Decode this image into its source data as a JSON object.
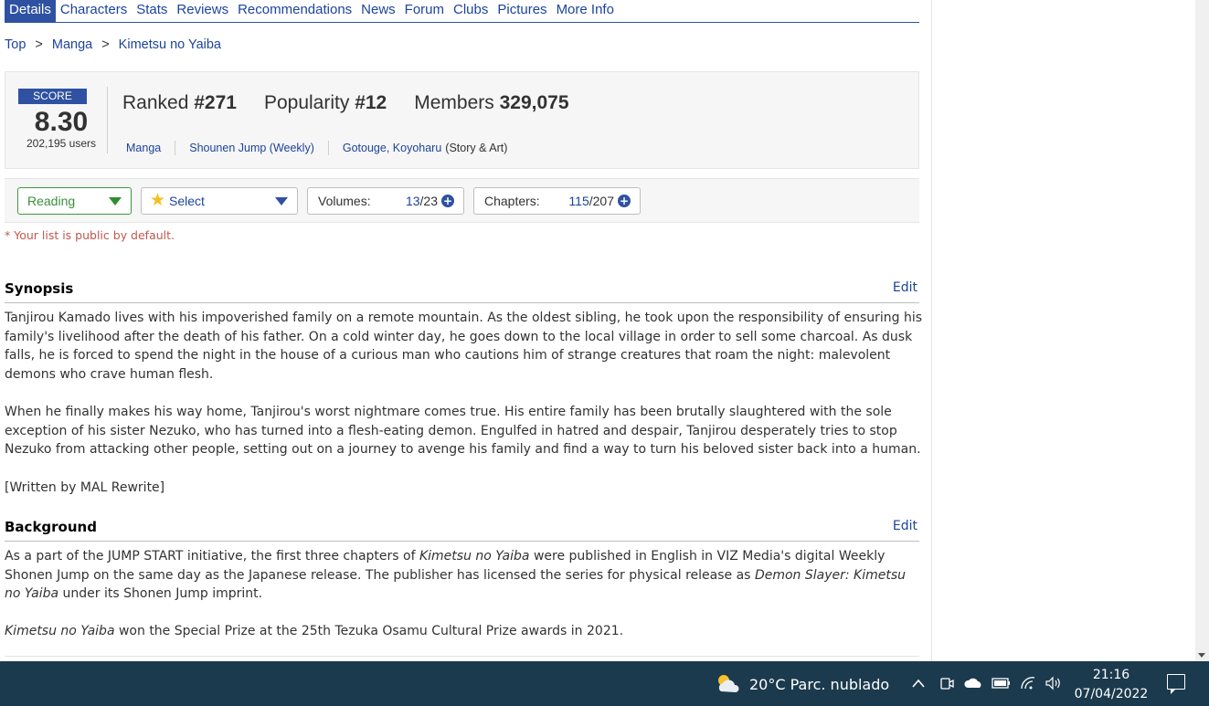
{
  "tabs": [
    "Details",
    "Characters",
    "Stats",
    "Reviews",
    "Recommendations",
    "News",
    "Forum",
    "Clubs",
    "Pictures",
    "More Info"
  ],
  "breadcrumb": {
    "top": "Top",
    "sep": ">",
    "manga": "Manga",
    "title": "Kimetsu no Yaiba"
  },
  "stats": {
    "score_label": "SCORE",
    "score": "8.30",
    "users": "202,195 users",
    "ranked_label": "Ranked",
    "ranked": "#271",
    "popularity_label": "Popularity",
    "popularity": "#12",
    "members_label": "Members",
    "members": "329,075",
    "type": "Manga",
    "serialization": "Shounen Jump (Weekly)",
    "author": "Gotouge, Koyoharu",
    "author_role": "(Story & Art)"
  },
  "list": {
    "status": "Reading",
    "score_select": "Select",
    "volumes_label": "Volumes:",
    "volumes_read": "13",
    "volumes_total": "/23",
    "chapters_label": "Chapters:",
    "chapters_read": "115",
    "chapters_total": "/207",
    "public_note": "* Your list is public by default."
  },
  "synopsis": {
    "title": "Synopsis",
    "edit": "Edit",
    "p1": "Tanjirou Kamado lives with his impoverished family on a remote mountain. As the oldest sibling, he took upon the responsibility of ensuring his family's livelihood after the death of his father. On a cold winter day, he goes down to the local village in order to sell some charcoal. As dusk falls, he is forced to spend the night in the house of a curious man who cautions him of strange creatures that roam the night: malevolent demons who crave human flesh.",
    "p2": "When he finally makes his way home, Tanjirou's worst nightmare comes true. His entire family has been brutally slaughtered with the sole exception of his sister Nezuko, who has turned into a flesh-eating demon. Engulfed in hatred and despair, Tanjirou desperately tries to stop Nezuko from attacking other people, setting out on a journey to avenge his family and find a way to turn his beloved sister back into a human.",
    "p3": "[Written by MAL Rewrite]"
  },
  "background": {
    "title": "Background",
    "edit": "Edit",
    "p1_a": "As a part of the JUMP START initiative, the first three chapters of ",
    "p1_b": "Kimetsu no Yaiba",
    "p1_c": " were published in English in VIZ Media's digital Weekly Shonen Jump on the same day as the Japanese release. The publisher has licensed the series for physical release as ",
    "p1_d": "Demon Slayer: Kimetsu no Yaiba",
    "p1_e": " under its Shonen Jump imprint.",
    "p2_a": "Kimetsu no Yaiba",
    "p2_b": " won the Special Prize at the 25th Tezuka Osamu Cultural Prize awards in 2021."
  },
  "taskbar": {
    "weather": "20°C  Parc. nublado",
    "time": "21:16",
    "date": "07/04/2022",
    "icons": [
      "chevron-up-icon",
      "meet-now-icon",
      "onedrive-icon",
      "battery-icon",
      "wifi-icon",
      "volume-icon",
      "notification-icon"
    ]
  },
  "colors": {
    "link": "#1c439b",
    "accent": "#2e51a2",
    "status_green": "#2f8f2f",
    "taskbar": "#1b3a4d",
    "note_red": "#c0584d"
  }
}
